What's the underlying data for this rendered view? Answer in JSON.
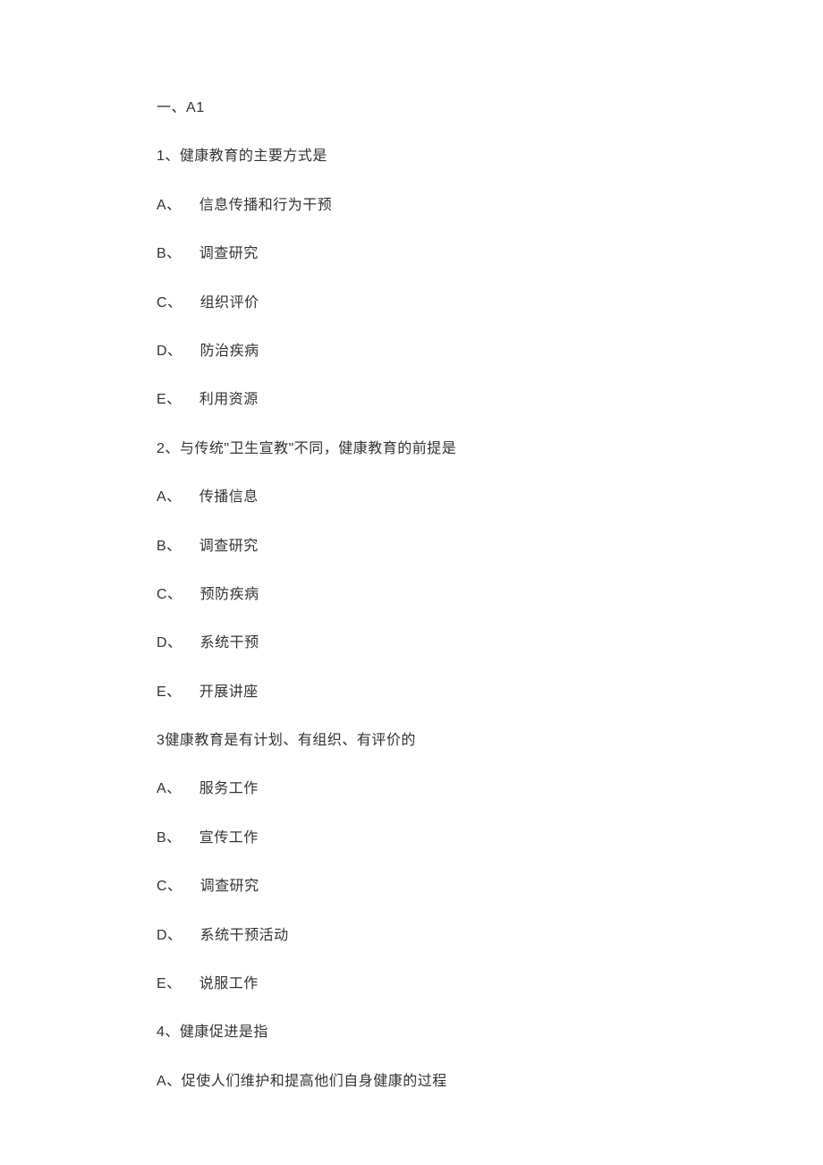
{
  "section": {
    "prefix": "一、",
    "code": "A1"
  },
  "questions": [
    {
      "number": "1、",
      "text": "健康教育的主要方式是",
      "options": [
        {
          "letter": "A、",
          "text": "信息传播和行为干预"
        },
        {
          "letter": "B、",
          "text": "调查研究"
        },
        {
          "letter": "C、",
          "text": "组织评价"
        },
        {
          "letter": "D、",
          "text": "防治疾病"
        },
        {
          "letter": "E、",
          "text": "利用资源"
        }
      ]
    },
    {
      "number": "2、",
      "text": "与传统\"卫生宣教\"不同，健康教育的前提是",
      "options": [
        {
          "letter": "A、",
          "text": "传播信息"
        },
        {
          "letter": "B、",
          "text": "调查研究"
        },
        {
          "letter": "C、",
          "text": "预防疾病"
        },
        {
          "letter": "D、",
          "text": "系统干预"
        },
        {
          "letter": "E、",
          "text": "开展讲座"
        }
      ]
    },
    {
      "number": "3",
      "text": "健康教育是有计划、有组织、有评价的",
      "options": [
        {
          "letter": "A、",
          "text": "服务工作"
        },
        {
          "letter": "B、",
          "text": "宣传工作"
        },
        {
          "letter": "C、",
          "text": "调查研究"
        },
        {
          "letter": "D、",
          "text": "系统干预活动"
        },
        {
          "letter": "E、",
          "text": "说服工作"
        }
      ]
    },
    {
      "number": "4、",
      "text": "健康促进是指",
      "options": [
        {
          "letter": "A、",
          "text": "促使人们维护和提高他们自身健康的过程"
        }
      ]
    }
  ]
}
